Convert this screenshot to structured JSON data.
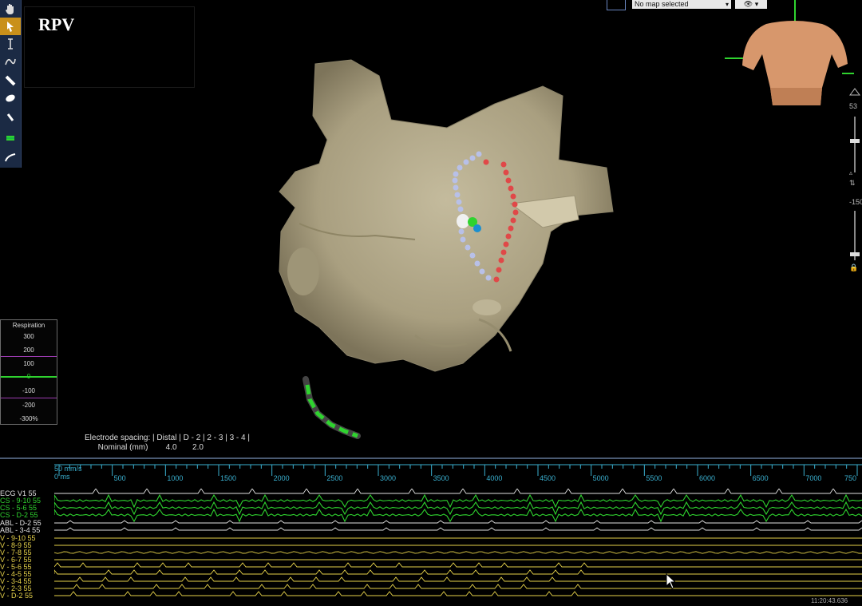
{
  "view": {
    "label": "RPV"
  },
  "toolbar": {
    "tools": [
      {
        "name": "hand-tool-icon",
        "active": false
      },
      {
        "name": "select-pointer-icon",
        "active": true
      },
      {
        "name": "text-cursor-icon",
        "active": false
      },
      {
        "name": "freehand-line-icon",
        "active": false
      },
      {
        "name": "catheter-icon",
        "active": false
      },
      {
        "name": "ellipse-icon",
        "active": false
      },
      {
        "name": "probe-icon",
        "active": false
      },
      {
        "name": "green-tag-icon",
        "active": false
      },
      {
        "name": "curve-icon",
        "active": false
      }
    ]
  },
  "map_selector": {
    "value": "No map selected",
    "eye_label": "👁"
  },
  "right_panel": {
    "top_value": "53",
    "bottom_value": "-150"
  },
  "respiration": {
    "title": "Respiration",
    "labels": [
      "300",
      "200",
      "100",
      "0",
      "-100",
      "-200",
      "-300%"
    ]
  },
  "electrode_spacing": {
    "line1": "Electrode spacing: | Distal | D - 2 | 2 - 3 | 3 - 4 |",
    "line2": "      Nominal (mm)        4.0       2.0"
  },
  "egm": {
    "sweep_speed": "50 mm/s",
    "start": "0 ms",
    "ticks": [
      "500",
      "1000",
      "1500",
      "2000",
      "2500",
      "3000",
      "3500",
      "4000",
      "4500",
      "5000",
      "5500",
      "6000",
      "6500",
      "7000",
      "750"
    ],
    "channels": [
      {
        "label": "ECG V1 55",
        "color": "#e0e0e0"
      },
      {
        "label": "CS - 9-10 55",
        "color": "#2fd32f"
      },
      {
        "label": "CS - 5-6 55",
        "color": "#2fd32f"
      },
      {
        "label": "CS - D-2 55",
        "color": "#2fd32f"
      },
      {
        "label": "ABL - D-2 55",
        "color": "#e0e0e0"
      },
      {
        "label": "ABL - 3-4 55",
        "color": "#e0e0e0"
      },
      {
        "label": "V - 9-10 55",
        "color": "#e6d24a"
      },
      {
        "label": "V - 8-9 55",
        "color": "#e6d24a"
      },
      {
        "label": "V - 7-8 55",
        "color": "#e6d24a"
      },
      {
        "label": "V - 6-7 55",
        "color": "#e6d24a"
      },
      {
        "label": "V - 5-6 55",
        "color": "#e6d24a"
      },
      {
        "label": "V - 4-5 55",
        "color": "#e6d24a"
      },
      {
        "label": "V - 3-4 55",
        "color": "#e6d24a"
      },
      {
        "label": "V - 2-3 55",
        "color": "#e6d24a"
      },
      {
        "label": "V - D-2 55",
        "color": "#e6d24a"
      }
    ],
    "time": "11:20:43.636"
  },
  "colors": {
    "model": "#b1a88b",
    "ablation_point": "#e04848",
    "mapping_point": "#b8c0e8",
    "catheter_tip": "#2fd32f",
    "toolbar_bg": "#1b2a44",
    "accent_active": "#c9901a",
    "ruler": "#3ab0d0"
  }
}
